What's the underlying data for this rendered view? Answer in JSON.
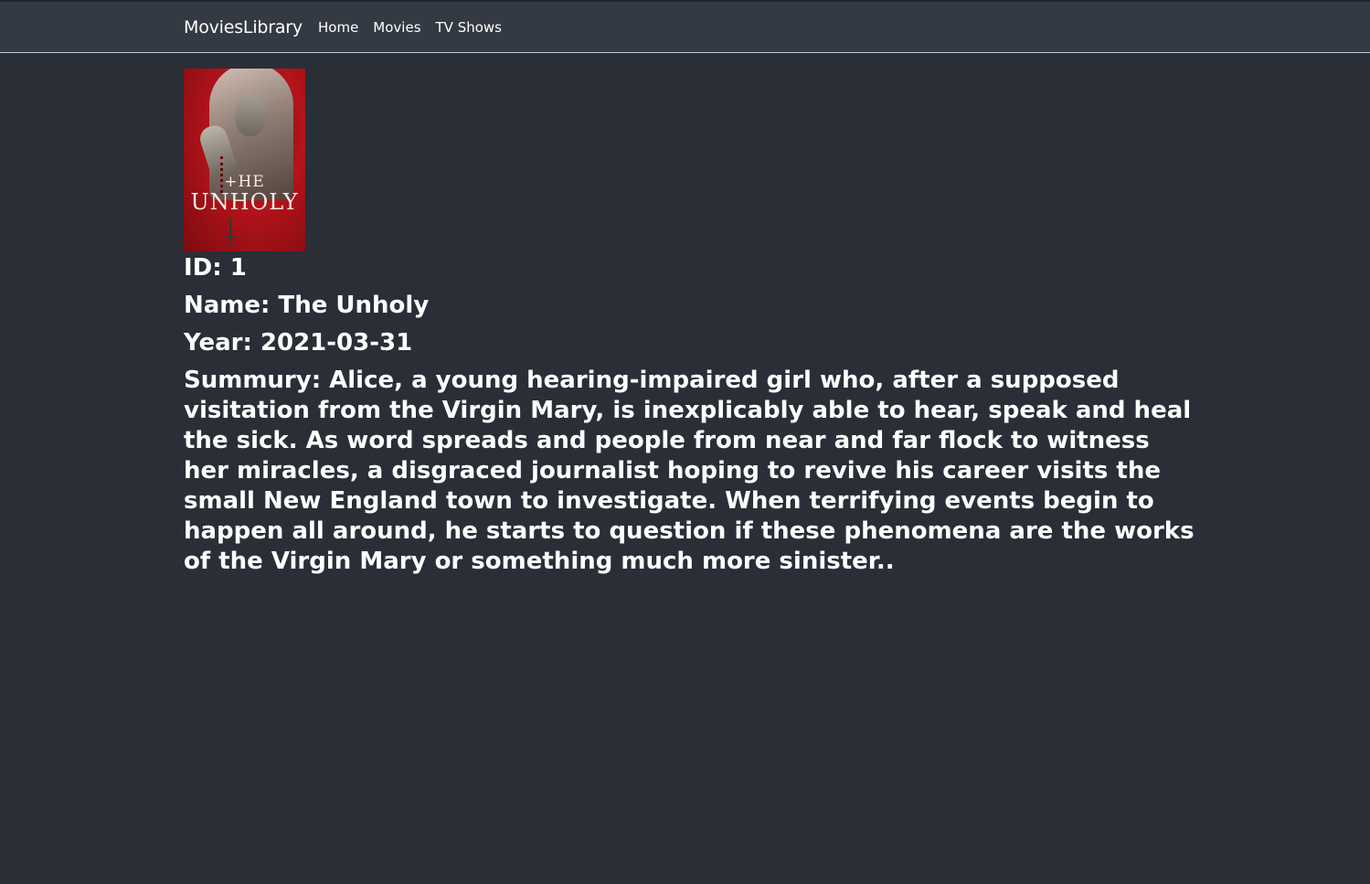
{
  "navbar": {
    "brand": "MoviesLibrary",
    "links": [
      "Home",
      "Movies",
      "TV Shows"
    ]
  },
  "poster": {
    "title_line1": "+HE",
    "title_line2": "UNHOLY"
  },
  "movie": {
    "id": "ID: 1",
    "name": "Name: The Unholy",
    "year": "Year: 2021-03-31",
    "summary": "Summury: Alice, a young hearing-impaired girl who, after a supposed visitation from the Virgin Mary, is inexplicably able to hear, speak and heal the sick. As word spreads and people from near and far flock to witness her miracles, a disgraced journalist hoping to revive his career visits the small New England town to investigate. When terrifying events begin to happen all around, he starts to question if these phenomena are the works of the Virgin Mary or something much more sinister.."
  },
  "colors": {
    "background": "#2a2e37",
    "navbar": "#343a43",
    "text": "#ffffff"
  }
}
